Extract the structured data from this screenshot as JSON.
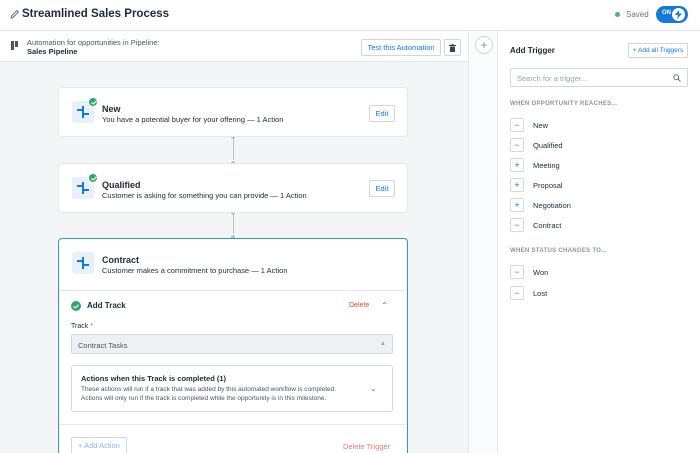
{
  "header": {
    "title": "Streamlined Sales Process",
    "saved_label": "Saved",
    "toggle_label": "ON"
  },
  "subheader": {
    "description": "Automation for opportunities in Pipeline:",
    "pipeline_name": "Sales Pipeline",
    "test_button": "Test this Automation"
  },
  "stages": [
    {
      "title": "New",
      "description": "You have a potential buyer for your offering — 1 Action",
      "edit_label": "Edit"
    },
    {
      "title": "Qualified",
      "description": "Customer is asking for something you can provide — 1 Action",
      "edit_label": "Edit"
    },
    {
      "title": "Contract",
      "description": "Customer makes a commitment to purchase — 1 Action"
    }
  ],
  "track": {
    "title": "Add Track",
    "delete_label": "Delete",
    "field_label": "Track",
    "required_mark": "*",
    "selected_value": "Contract Tasks",
    "actions_title": "Actions when this Track is completed (1)",
    "actions_desc_1": "These actions will run if a track that was added by this automated workflow is completed.",
    "actions_desc_2": "Actions will only run if the track is completed while the opportunity is in this milestone.",
    "add_action_label": "+ Add Action",
    "delete_trigger_label": "Delete Trigger"
  },
  "panel": {
    "title": "Add Trigger",
    "add_all_label": "+ Add all Triggers",
    "search_placeholder": "Search for a trigger...",
    "section_reach": "WHEN OPPORTUNITY REACHES...",
    "reach_items": [
      {
        "label": "New",
        "state": "minus"
      },
      {
        "label": "Qualified",
        "state": "minus"
      },
      {
        "label": "Meeting",
        "state": "plus"
      },
      {
        "label": "Proposal",
        "state": "plus"
      },
      {
        "label": "Negotiation",
        "state": "plus"
      },
      {
        "label": "Contract",
        "state": "minus"
      }
    ],
    "section_status": "WHEN STATUS CHANGES TO...",
    "status_items": [
      {
        "label": "Won",
        "state": "minus"
      },
      {
        "label": "Lost",
        "state": "minus"
      }
    ]
  },
  "colors": {
    "accent": "#1679d6",
    "success": "#32a46c",
    "danger": "#d9463b"
  },
  "icons": [
    "pencil-icon",
    "automation-icon",
    "trash-icon",
    "lightning-icon",
    "stage-icon",
    "check-icon",
    "chevron-up-icon",
    "chevron-down-icon",
    "search-icon",
    "plus-icon",
    "minus-icon"
  ]
}
